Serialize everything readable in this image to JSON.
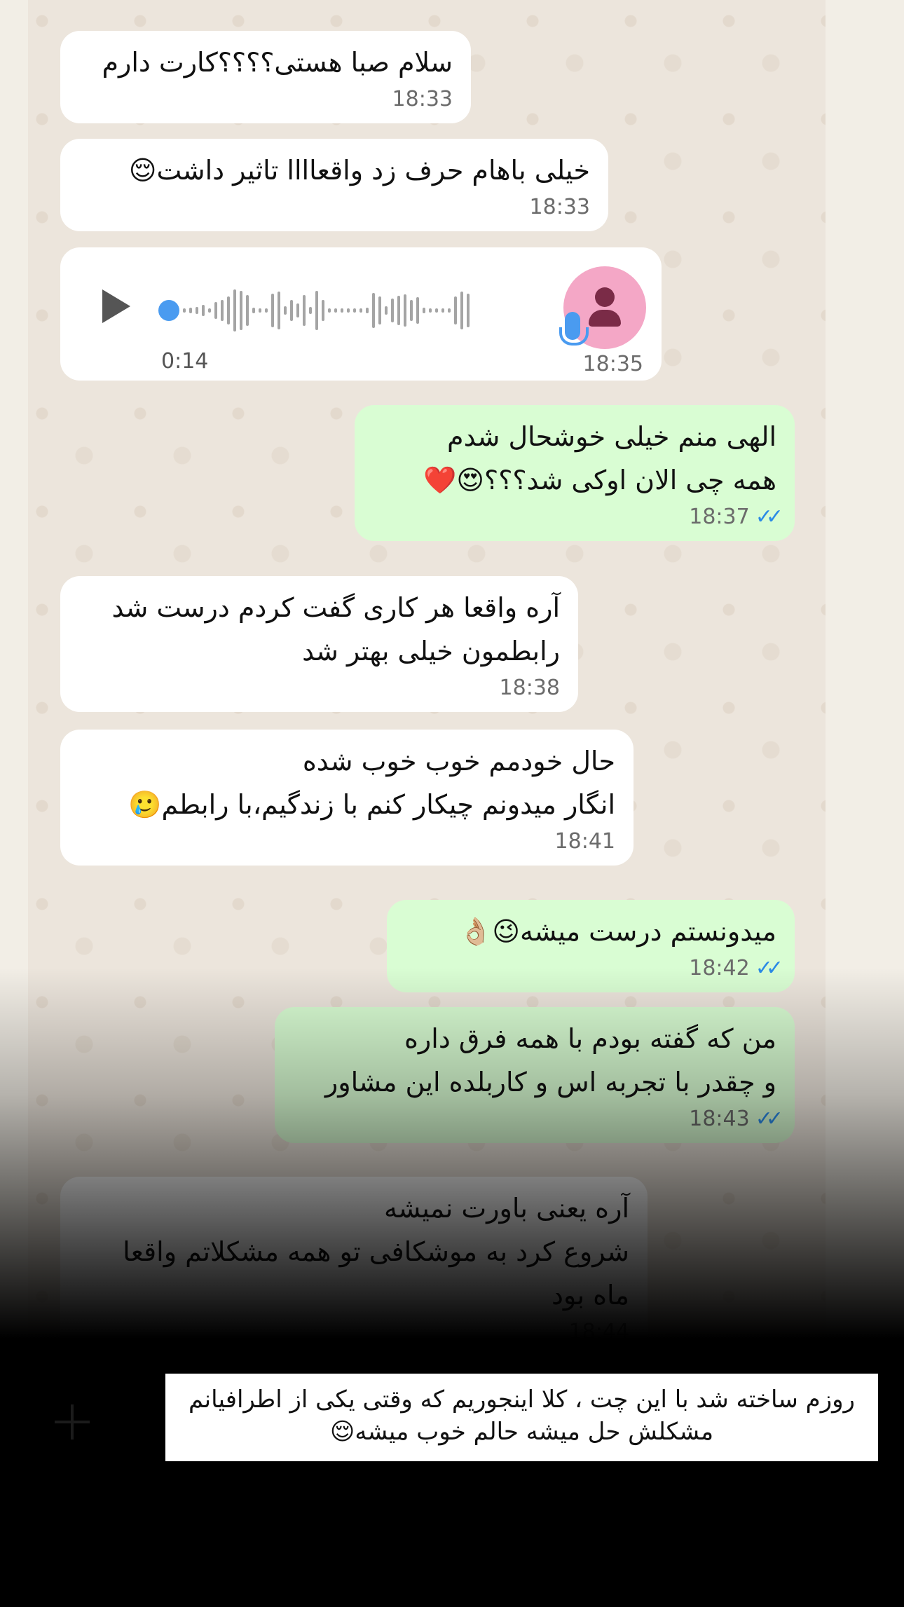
{
  "messages": [
    {
      "id": "m1",
      "dir": "in",
      "text": "سلام صبا هستی؟؟؟؟کارت دارم",
      "time": "18:33"
    },
    {
      "id": "m2",
      "dir": "in",
      "text": "خیلی باهام حرف زد واقعاااا تاثیر داشت😌",
      "time": "18:33"
    },
    {
      "id": "m3",
      "dir": "in",
      "type": "voice",
      "duration": "0:14",
      "time": "18:35"
    },
    {
      "id": "m4",
      "dir": "out",
      "text": "الهی منم خیلی خوشحال شدم\nهمه چی الان اوکی شد؟؟؟😍❤️",
      "time": "18:37"
    },
    {
      "id": "m5",
      "dir": "in",
      "text": "آره واقعا هر کاری گفت کردم درست شد\nرابطمون خیلی بهتر شد",
      "time": "18:38"
    },
    {
      "id": "m6",
      "dir": "in",
      "text": "حال خودمم خوب خوب شده\nانگار میدونم چیکار کنم با زندگیم،با رابطم🥲",
      "time": "18:41"
    },
    {
      "id": "m7",
      "dir": "out",
      "text": "میدونستم درست میشه😉👌🏼",
      "time": "18:42"
    },
    {
      "id": "m8",
      "dir": "out",
      "text": "من که گفته بودم با همه فرق داره\nو چقدر با تجربه اس و کاربلده این مشاور",
      "time": "18:43"
    },
    {
      "id": "m9",
      "dir": "in",
      "text": "آره یعنی باورت نمیشه\nشروع کرد به موشکافی تو همه مشکلاتم واقعا\nماه بود",
      "time": "18:44"
    }
  ],
  "caption": "روزم ساخته شد با این چت ، کلا اینجوریم که وقتی یکی از اطرافیانم مشکلش حل میشه حالم خوب میشه😌",
  "ticks": "✓✓",
  "colors": {
    "incoming": "#ffffff",
    "outgoing": "#d9fdd3",
    "read_ticks": "#2b8ae6",
    "wallpaper": "#ece5dc"
  }
}
